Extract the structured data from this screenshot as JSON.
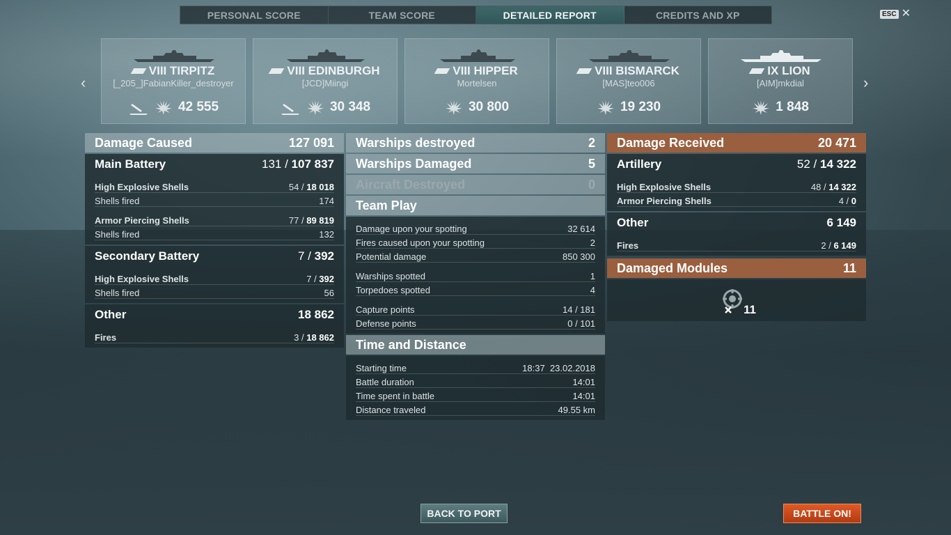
{
  "tabs": [
    {
      "label": "PERSONAL SCORE"
    },
    {
      "label": "TEAM SCORE"
    },
    {
      "label": "DETAILED REPORT",
      "active": true
    },
    {
      "label": "CREDITS AND XP"
    }
  ],
  "esc": {
    "key": "ESC",
    "close": "✕"
  },
  "nav": {
    "prev": "‹",
    "next": "›"
  },
  "players": [
    {
      "ship": "VIII TIRPITZ",
      "player": "[_205_]FabianKiller_destroyer",
      "damage": "42 555",
      "kills": true
    },
    {
      "ship": "VIII EDINBURGH",
      "player": "[JCD]Miingi",
      "damage": "30 348",
      "kills": true
    },
    {
      "ship": "VIII HIPPER",
      "player": "Mortelsen",
      "damage": "30 800",
      "kills": false
    },
    {
      "ship": "VIII BISMARCK",
      "player": "[MAS]teo006",
      "damage": "19 230",
      "kills": false
    },
    {
      "ship": "IX LION",
      "player": "[AIM]mkdial",
      "damage": "1 848",
      "kills": false
    }
  ],
  "damage_caused": {
    "title": "Damage Caused",
    "value": "127 091",
    "main_battery": {
      "title": "Main Battery",
      "hits": "131",
      "dmg": "107 837"
    },
    "mb_he": {
      "label": "High Explosive Shells",
      "hits": "54",
      "dmg": "18 018"
    },
    "mb_he_fired": {
      "label": "Shells fired",
      "value": "174"
    },
    "mb_ap": {
      "label": "Armor Piercing Shells",
      "hits": "77",
      "dmg": "89 819"
    },
    "mb_ap_fired": {
      "label": "Shells fired",
      "value": "132"
    },
    "secondary": {
      "title": "Secondary Battery",
      "hits": "7",
      "dmg": "392"
    },
    "sec_he": {
      "label": "High Explosive Shells",
      "hits": "7",
      "dmg": "392"
    },
    "sec_fired": {
      "label": "Shells fired",
      "value": "56"
    },
    "other": {
      "title": "Other",
      "value": "18 862"
    },
    "fires": {
      "label": "Fires",
      "hits": "3",
      "dmg": "18 862"
    }
  },
  "middle": {
    "destroyed": {
      "label": "Warships destroyed",
      "value": "2"
    },
    "damaged": {
      "label": "Warships Damaged",
      "value": "5"
    },
    "aircraft": {
      "label": "Aircraft Destroyed",
      "value": "0"
    },
    "team_play": {
      "title": "Team Play"
    },
    "spot_dmg": {
      "label": "Damage upon your spotting",
      "value": "32 614"
    },
    "spot_fires": {
      "label": "Fires caused upon your spotting",
      "value": "2"
    },
    "potential": {
      "label": "Potential damage",
      "value": "850 300"
    },
    "spotted": {
      "label": "Warships spotted",
      "value": "1"
    },
    "torps": {
      "label": "Torpedoes spotted",
      "value": "4"
    },
    "capture": {
      "label": "Capture points",
      "value": "14 / 181"
    },
    "defense": {
      "label": "Defense points",
      "value": "0 / 101"
    },
    "time_title": {
      "title": "Time and Distance"
    },
    "start": {
      "label": "Starting time",
      "value": "18:37  23.02.2018"
    },
    "duration": {
      "label": "Battle duration",
      "value": "14:01"
    },
    "spent": {
      "label": "Time spent in battle",
      "value": "14:01"
    },
    "distance": {
      "label": "Distance traveled",
      "value": "49.55 km"
    }
  },
  "damage_received": {
    "title": "Damage Received",
    "value": "20 471",
    "artillery": {
      "title": "Artillery",
      "hits": "52",
      "dmg": "14 322"
    },
    "he": {
      "label": "High Explosive Shells",
      "hits": "48",
      "dmg": "14 322"
    },
    "ap": {
      "label": "Armor Piercing Shells",
      "hits": "4",
      "dmg": "0"
    },
    "other": {
      "title": "Other",
      "value": "6 149"
    },
    "fires": {
      "label": "Fires",
      "hits": "2",
      "dmg": "6 149"
    },
    "modules": {
      "title": "Damaged Modules",
      "value": "11",
      "count": "11"
    }
  },
  "buttons": {
    "port": "BACK TO PORT",
    "battle": "BATTLE ON!"
  },
  "colors": {
    "accent_tab": "#3f7d7f",
    "received": "#9a5f3f",
    "battle_btn": "#cf4a1a"
  }
}
